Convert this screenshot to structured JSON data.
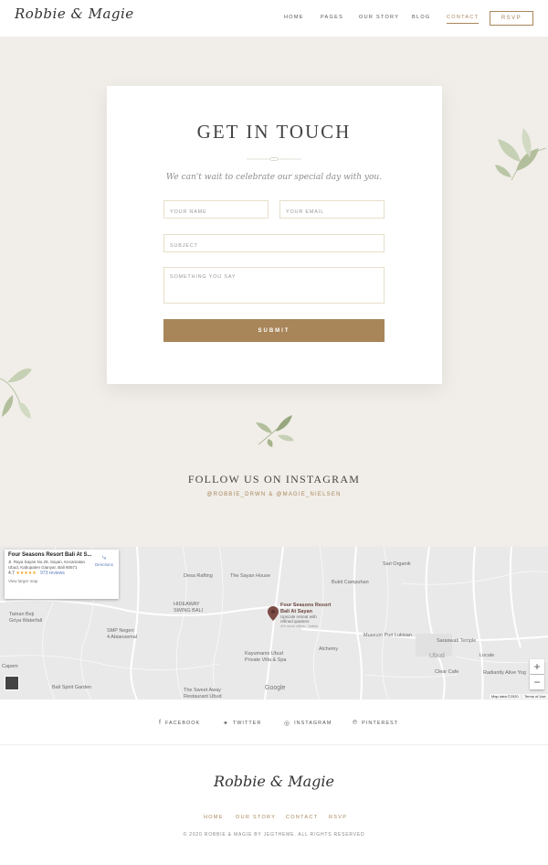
{
  "header": {
    "logo": "Robbie & Magie",
    "nav": [
      "HOME",
      "PAGES",
      "OUR STORY",
      "BLOG",
      "CONTACT"
    ],
    "rsvp": "RSVP"
  },
  "contact": {
    "title": "GET IN TOUCH",
    "subtitle": "We can't wait to celebrate our special day with you.",
    "name_placeholder": "YOUR NAME",
    "email_placeholder": "YOUR EMAIL",
    "subject_placeholder": "SUBJECT",
    "message_placeholder": "SOMETHING YOU SAY",
    "submit": "SUBMIT"
  },
  "instagram": {
    "title": "FOLLOW US ON INSTAGRAM",
    "handles": "@ROBBIE_DRWN & @MAGIE_NIELSEN"
  },
  "map": {
    "place_name": "Four Seasons Resort Bali At S...",
    "address": "Jl. Raya Sayan No.29, Sayan, Kecamatan Ubud, Kabupaten Gianyar, Bali 80571",
    "rating": "4.7",
    "stars": "★★★★★",
    "reviews": "973 reviews",
    "view_larger": "View larger map",
    "directions": "Directions",
    "marker_title": "Four Seasons Resort Bali At Sayan",
    "marker_sub1": "Upscale retreat with",
    "marker_sub2": "refined quarters",
    "marker_sub3": "4% more offers · hotels",
    "labels": {
      "desa_rafting": "Desa Rafting",
      "sayan_house": "The Sayan House",
      "sari_organik": "Sari Organik",
      "bukit_campuhan": "Bukit Campuhan",
      "hideaway1": "HIDEAWAY",
      "hideaway2": "SWING BALI",
      "smp1": "SMP Negeri",
      "smp2": "4 Abiansemal",
      "taman1": "Taman Beji",
      "taman2": "Griya Waterfall",
      "puri_lukisan": "Museum Puri Lukisan",
      "saraswati": "Saraswati Temple",
      "ubud": "Ubud",
      "kayumanis1": "Kayumanis Ubud",
      "kayumanis2": "Private Villa & Spa",
      "alchemy": "Alchemy",
      "locale": "Locale",
      "clear_cafe": "Clear Cafe",
      "radiantly": "Radiantly Alive Yog",
      "bali_spirit": "Bali Spirit Garden",
      "sweet_away1": "The Sweet Away",
      "sweet_away2": "Restaurant Ubud",
      "capem": "Capem",
      "google": "Google",
      "map_data": "Map data ©2020",
      "terms": "Terms of Use"
    },
    "zoom_in": "+",
    "zoom_out": "−"
  },
  "social": [
    "FACEBOOK",
    "TWITTER",
    "INSTAGRAM",
    "PINTEREST"
  ],
  "footer": {
    "logo": "Robbie & Magie",
    "nav": [
      "HOME",
      "OUR STORY",
      "CONTACT",
      "RSVP"
    ],
    "copyright": "© 2020 ROBBIE & MAGIE BY JEGTHEME. ALL RIGHTS RESERVED"
  }
}
